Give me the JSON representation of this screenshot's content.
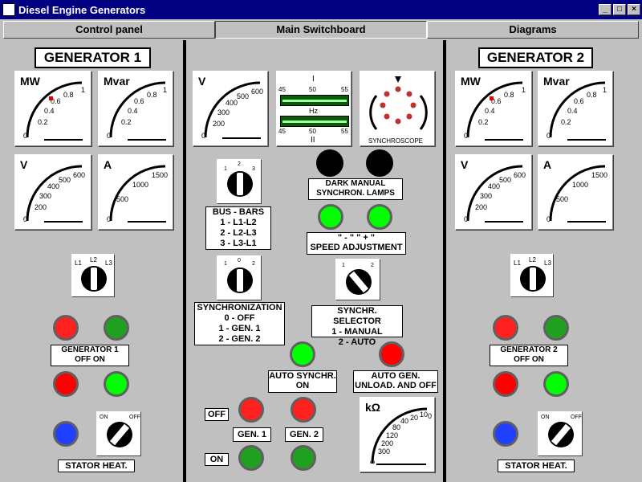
{
  "window": {
    "title": "Diesel Engine Generators",
    "controls": [
      "_",
      "□",
      "×"
    ]
  },
  "tabs": [
    {
      "label": "Control panel",
      "active": false
    },
    {
      "label": "Main Switchboard",
      "active": true
    },
    {
      "label": "Diagrams",
      "active": false
    }
  ],
  "gen1": {
    "title": "GENERATOR 1",
    "mw": {
      "title": "MW",
      "ticks": [
        "0",
        "0.2",
        "0.4",
        "0.6",
        "0.8",
        "1"
      ]
    },
    "mvar": {
      "title": "Mvar",
      "ticks": [
        "0",
        "0.2",
        "0.4",
        "0.6",
        "0.8",
        "1"
      ]
    },
    "v": {
      "title": "V",
      "ticks": [
        "0",
        "200",
        "300",
        "400",
        "500",
        "600"
      ]
    },
    "a": {
      "title": "A",
      "ticks": [
        "0",
        "500",
        "1000",
        "1500"
      ]
    },
    "selector": {
      "l1": "L1",
      "l2": "L2",
      "l3": "L3"
    },
    "breaker_label": "GENERATOR 1\nOFF           ON",
    "stator_label": "STATOR HEAT.",
    "stator_switch": {
      "on": "ON",
      "off": "OFF"
    }
  },
  "gen2": {
    "title": "GENERATOR 2",
    "mw": {
      "title": "MW",
      "ticks": [
        "0",
        "0.2",
        "0.4",
        "0.6",
        "0.8",
        "1"
      ]
    },
    "mvar": {
      "title": "Mvar",
      "ticks": [
        "0",
        "0.2",
        "0.4",
        "0.6",
        "0.8",
        "1"
      ]
    },
    "v": {
      "title": "V",
      "ticks": [
        "0",
        "200",
        "300",
        "400",
        "500",
        "600"
      ]
    },
    "a": {
      "title": "A",
      "ticks": [
        "0",
        "500",
        "1000",
        "1500"
      ]
    },
    "selector": {
      "l1": "L1",
      "l2": "L2",
      "l3": "L3"
    },
    "breaker_label": "GENERATOR 2\nOFF           ON",
    "stator_label": "STATOR HEAT.",
    "stator_switch": {
      "on": "ON",
      "off": "OFF"
    }
  },
  "center": {
    "bus_v": {
      "title": "V",
      "ticks": [
        "0",
        "200",
        "300",
        "400",
        "500",
        "600"
      ]
    },
    "freq": {
      "top": "I",
      "bottom": "II",
      "unit": "Hz",
      "scale_top": [
        "45",
        "50",
        "55"
      ],
      "scale_bottom": [
        "45",
        "50",
        "55"
      ]
    },
    "synchroscope": {
      "label": "SYNCHROSCOPE"
    },
    "dark_lamps_label": "DARK MANUAL\nSYNCHRON. LAMPS",
    "speed_label": "\" - \"              \" + \"\nSPEED ADJUSTMENT",
    "bus_knob": {
      "p1": "1",
      "p2": "2",
      "p3": "3"
    },
    "bus_label": "BUS - BARS\n1 - L1-L2\n2 - L2-L3\n3 - L3-L1",
    "sync_knob": {
      "p0": "0",
      "p1": "1",
      "p2": "2"
    },
    "sync_label": "SYNCHRONIZATION\n0 - OFF\n1 - GEN. 1\n2 - GEN. 2",
    "sel_knob": {
      "p1": "1",
      "p2": "2"
    },
    "sel_label": "SYNCHR. SELECTOR\n1 - MANUAL\n2 - AUTO",
    "auto_synch_label": "AUTO SYNCHR.\nON",
    "auto_gen_label": "AUTO GEN.\nUNLOAD. AND OFF",
    "off_label": "OFF",
    "on_label": "ON",
    "gen1_label": "GEN. 1",
    "gen2_label": "GEN. 2",
    "kohm": {
      "title": "kΩ",
      "ticks": [
        "∞",
        "300",
        "200",
        "120",
        "80",
        "40",
        "20",
        "10",
        "0"
      ]
    }
  }
}
